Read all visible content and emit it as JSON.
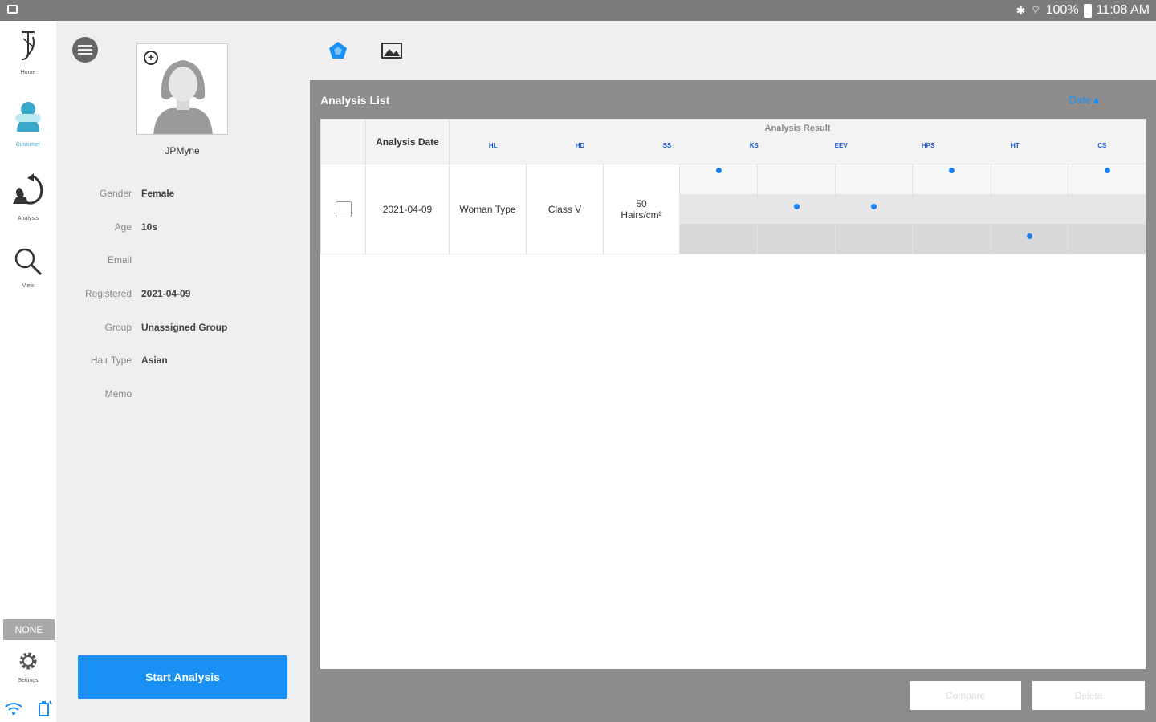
{
  "status_bar": {
    "battery": "100%",
    "time": "11:08 AM",
    "colors": {
      "background": "#7b7b7b"
    }
  },
  "nav": {
    "items": [
      {
        "label": "Home",
        "icon": "home-logo-icon"
      },
      {
        "label": "Customer",
        "icon": "customer-icon",
        "active": true
      },
      {
        "label": "Analysis",
        "icon": "analysis-icon"
      },
      {
        "label": "View",
        "icon": "magnifier-icon"
      }
    ],
    "none_badge": "NONE",
    "settings_label": "Settings",
    "active_color": "#3aa9c9"
  },
  "customer": {
    "name": "JPMyne",
    "fields": [
      {
        "label": "Gender",
        "value": "Female"
      },
      {
        "label": "Age",
        "value": "10s"
      },
      {
        "label": "Email",
        "value": ""
      },
      {
        "label": "Registered",
        "value": "2021-04-09"
      },
      {
        "label": "Group",
        "value": "Unassigned Group"
      },
      {
        "label": "Hair Type",
        "value": "Asian"
      },
      {
        "label": "Memo",
        "value": ""
      }
    ],
    "start_button": "Start Analysis"
  },
  "analysis_list": {
    "title": "Analysis List",
    "sort_label": "Date▲",
    "headers": {
      "date": "Analysis Date",
      "result": "Analysis Result",
      "result_columns": [
        "HL",
        "HD",
        "SS",
        "KS",
        "EEV",
        "HPS",
        "HT",
        "CS"
      ]
    },
    "rows": [
      {
        "date": "2021-04-09",
        "type": "Woman Type",
        "class": "Class V",
        "density": "50 Hairs/cm²",
        "levels": [
          1,
          2,
          2,
          1,
          3,
          1
        ]
      }
    ],
    "buttons": {
      "compare": "Compare",
      "delete": "Delete"
    },
    "colors": {
      "accent": "#1a90f5",
      "dot": "#1a80f0"
    }
  }
}
